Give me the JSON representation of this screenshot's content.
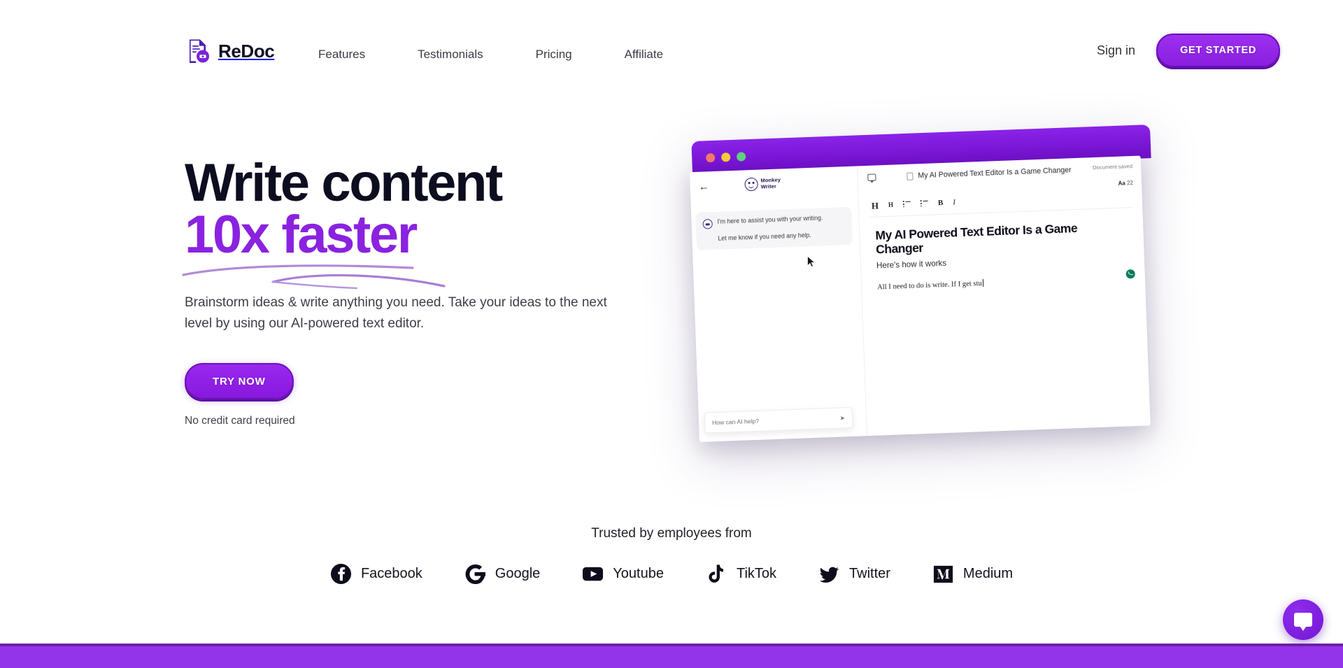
{
  "brand": {
    "name": "ReDoc",
    "logo_icon": "document-chat-icon",
    "accent": "#8a22e0",
    "ink": "#0d0d20"
  },
  "nav": {
    "items": [
      {
        "label": "Features"
      },
      {
        "label": "Testimonials"
      },
      {
        "label": "Pricing"
      },
      {
        "label": "Affiliate"
      }
    ],
    "sign_in_label": "Sign in",
    "get_started_label": "GET STARTED"
  },
  "hero": {
    "heading_line1": "Write content",
    "heading_line2": "10x faster",
    "subheading": "Brainstorm ideas & write anything you need. Take your ideas to the next level by using our AI-powered text editor.",
    "cta_label": "TRY NOW",
    "cta_note": "No credit card required"
  },
  "mockup": {
    "window_dots": [
      "red",
      "yellow",
      "green"
    ],
    "sidebar": {
      "back_icon": "←",
      "app_name_line1": "Monkey",
      "app_name_line2": "Writer",
      "messages": [
        "I'm here to assist you with your writing.",
        "Let me know if you need any help."
      ],
      "input_placeholder": "How can AI help?",
      "send_icon": "➤"
    },
    "editor": {
      "comment_icon": "speech-bubble-icon",
      "doc_icon": "document-icon",
      "doc_title": "My AI Powered Text Editor Is a Game Changer",
      "status": "Document saved",
      "font_label": "Aa",
      "font_size": "22",
      "toolbar": [
        "H",
        "H",
        "bullet-list",
        "numbered-list",
        "B",
        "I"
      ],
      "body_heading": "My AI Powered Text Editor Is a Game Changer",
      "body_subheading": "Here's how it works",
      "body_paragraph": "All I need to do is write. If I get stu",
      "grammar_badge": "check-icon"
    }
  },
  "trusted": {
    "label": "Trusted by employees from",
    "brands": [
      {
        "name": "Facebook",
        "icon": "facebook-icon"
      },
      {
        "name": "Google",
        "icon": "google-icon"
      },
      {
        "name": "Youtube",
        "icon": "youtube-icon"
      },
      {
        "name": "TikTok",
        "icon": "tiktok-icon"
      },
      {
        "name": "Twitter",
        "icon": "twitter-icon"
      },
      {
        "name": "Medium",
        "icon": "medium-icon"
      }
    ]
  },
  "footer": {
    "bar_color": "#9333ea",
    "bar_border": "#6b21a8"
  },
  "chat_widget": {
    "icon": "chat-bubble-icon",
    "color": "#7318d4"
  }
}
